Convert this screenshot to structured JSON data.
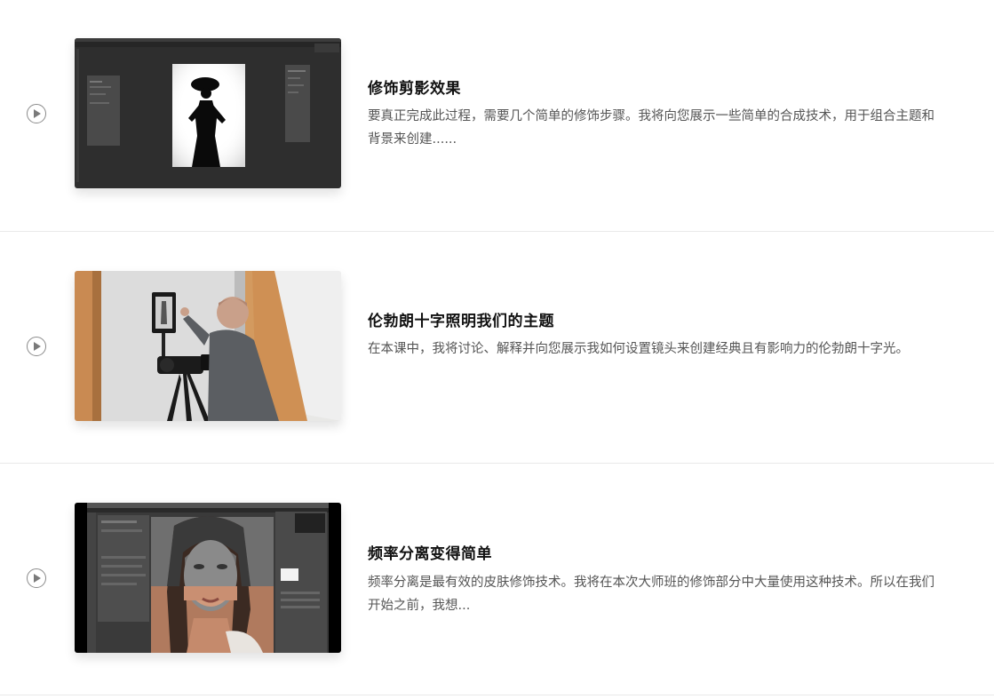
{
  "lessons": [
    {
      "title": "修饰剪影效果",
      "description": "要真正完成此过程，需要几个简单的修饰步骤。我将向您展示一些简单的合成技术，用于组合主题和背景来创建......",
      "thumbnail_icon": "photoshop-silhouette-thumbnail"
    },
    {
      "title": "伦勃朗十字照明我们的主题",
      "description": "在本课中，我将讨论、解释并向您展示我如何设置镜头来创建经典且有影响力的伦勃朗十字光。",
      "thumbnail_icon": "studio-camera-setup-thumbnail"
    },
    {
      "title": "频率分离变得简单",
      "description": "频率分离是最有效的皮肤修饰技术。我将在本次大师班的修饰部分中大量使用这种技术。所以在我们开始之前，我想...",
      "thumbnail_icon": "frequency-separation-thumbnail"
    }
  ],
  "colors": {
    "title": "#111111",
    "description": "#555555",
    "divider": "#e9e9e9",
    "play_icon": "#8a8a8a"
  }
}
